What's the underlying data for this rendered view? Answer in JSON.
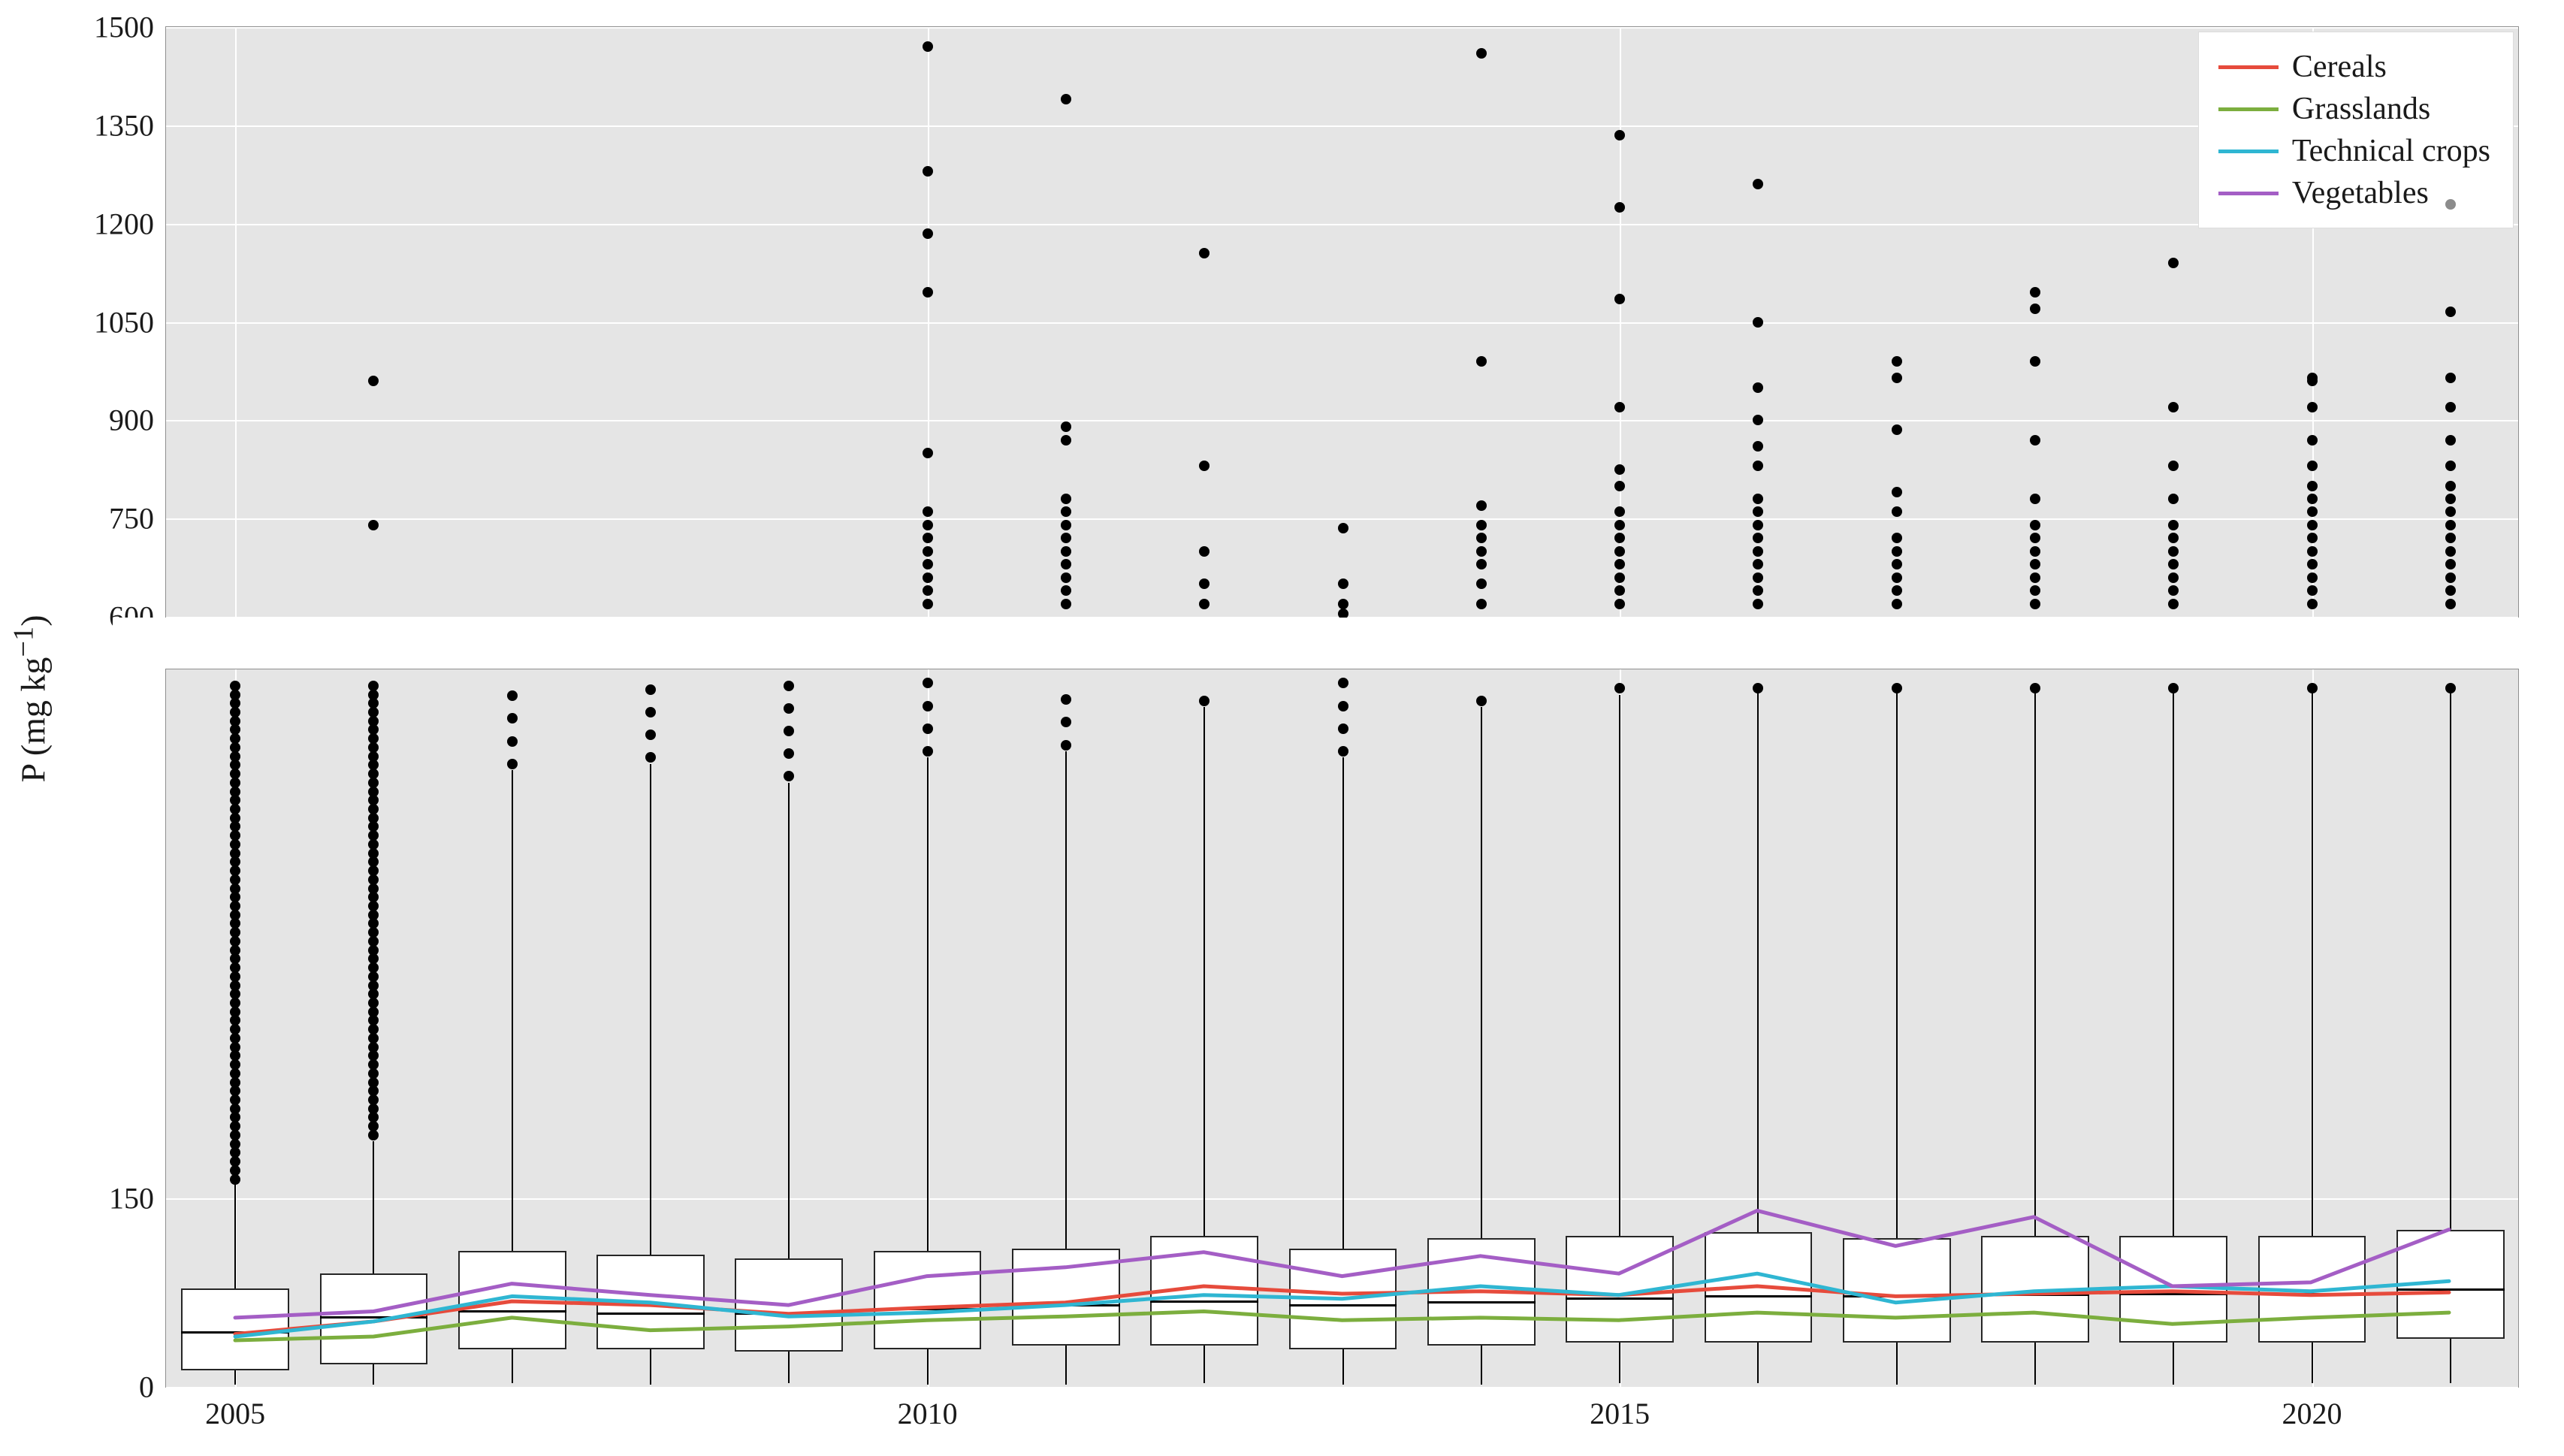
{
  "meta": {
    "x_years": [
      2005,
      2006,
      2007,
      2008,
      2009,
      2010,
      2011,
      2012,
      2013,
      2014,
      2015,
      2016,
      2017,
      2018,
      2019,
      2020,
      2021
    ]
  },
  "axes": {
    "ylabel_html": "P (mg kg<sup>−1</sup>)",
    "ylabel": "P (mg kg−1)",
    "upper": {
      "min": 600,
      "max": 1500,
      "ticks": [
        600,
        750,
        900,
        1050,
        1200,
        1350,
        1500
      ]
    },
    "lower": {
      "min": 0,
      "max": 200,
      "visible_max": 570,
      "ticks": [
        0,
        150
      ]
    },
    "xticks": [
      2005,
      2010,
      2015,
      2020
    ]
  },
  "series_colors": {
    "Cereals": "#e64b3c",
    "Grasslands": "#7cae3e",
    "Technical crops": "#2fb6d2",
    "Vegetables": "#a45ec5"
  },
  "chart_data": {
    "type": "boxplot+lines",
    "title": "",
    "xlabel": "",
    "ylabel": "P (mg kg−1)",
    "x": [
      2005,
      2006,
      2007,
      2008,
      2009,
      2010,
      2011,
      2012,
      2013,
      2014,
      2015,
      2016,
      2017,
      2018,
      2019,
      2020,
      2021
    ],
    "y_break": {
      "from": 200,
      "to": 570
    },
    "ylim_lower": [
      0,
      570
    ],
    "ylim_upper": [
      600,
      1500
    ],
    "box": {
      "q1": [
        13,
        18,
        30,
        30,
        28,
        30,
        33,
        33,
        30,
        33,
        35,
        35,
        35,
        35,
        35,
        35,
        38
      ],
      "median": [
        43,
        55,
        60,
        58,
        58,
        62,
        65,
        68,
        65,
        67,
        70,
        72,
        72,
        73,
        74,
        74,
        77
      ],
      "q3": [
        78,
        90,
        108,
        105,
        102,
        108,
        110,
        120,
        110,
        118,
        120,
        123,
        118,
        120,
        120,
        120,
        125
      ],
      "whisk_lo": [
        2,
        2,
        3,
        2,
        3,
        2,
        2,
        3,
        2,
        2,
        3,
        3,
        2,
        2,
        2,
        3,
        3
      ],
      "whisk_hi": [
        165,
        195,
        490,
        495,
        480,
        500,
        505,
        540,
        500,
        540,
        550,
        555,
        555,
        555,
        555,
        555,
        555
      ]
    },
    "outliers_upper": {
      "2005": [],
      "2006": [
        740,
        960
      ],
      "2007": [],
      "2008": [],
      "2009": [],
      "2010": [
        620,
        640,
        660,
        680,
        700,
        720,
        740,
        760,
        850,
        1095,
        1185,
        1280,
        1470
      ],
      "2011": [
        620,
        640,
        660,
        680,
        700,
        720,
        740,
        760,
        780,
        870,
        890,
        1390
      ],
      "2012": [
        620,
        650,
        700,
        830,
        1155
      ],
      "2013": [
        605,
        620,
        650,
        735
      ],
      "2014": [
        620,
        650,
        680,
        700,
        720,
        740,
        770,
        990,
        1460
      ],
      "2015": [
        620,
        640,
        660,
        680,
        700,
        720,
        740,
        760,
        800,
        825,
        920,
        1085,
        1225,
        1335
      ],
      "2016": [
        620,
        640,
        660,
        680,
        700,
        720,
        740,
        760,
        780,
        830,
        860,
        900,
        950,
        1050,
        1260
      ],
      "2017": [
        620,
        640,
        660,
        680,
        700,
        720,
        760,
        790,
        885,
        965,
        990
      ],
      "2018": [
        620,
        640,
        660,
        680,
        700,
        720,
        740,
        780,
        870,
        990,
        1070,
        1095
      ],
      "2019": [
        620,
        640,
        660,
        680,
        700,
        720,
        740,
        780,
        830,
        920,
        1140
      ],
      "2020": [
        620,
        640,
        660,
        680,
        700,
        720,
        740,
        760,
        780,
        800,
        830,
        870,
        920,
        960,
        965
      ],
      "2021": [
        620,
        640,
        660,
        680,
        700,
        720,
        740,
        760,
        780,
        800,
        830,
        870,
        920,
        965,
        1065,
        1230
      ]
    },
    "outliers_lower_clusters": {
      "2005": {
        "from": 165,
        "to": 560,
        "dense": true
      },
      "2006": {
        "from": 200,
        "to": 560,
        "dense": true
      },
      "2007": {
        "from": 495,
        "to": 560,
        "dense": false
      },
      "2008": {
        "from": 500,
        "to": 560,
        "dense": false
      },
      "2009": {
        "from": 485,
        "to": 560,
        "dense": false
      },
      "2010": {
        "from": 505,
        "to": 560,
        "dense": false
      },
      "2011": {
        "from": 510,
        "to": 560,
        "dense": false
      },
      "2012": {
        "from": 545,
        "to": 560,
        "dense": false
      },
      "2013": {
        "from": 505,
        "to": 560,
        "dense": false
      },
      "2014": {
        "from": 545,
        "to": 560,
        "dense": false
      },
      "2015": {
        "from": 555,
        "to": 560,
        "dense": false
      },
      "2016": {
        "from": 555,
        "to": 560,
        "dense": false
      },
      "2017": {
        "from": 555,
        "to": 560,
        "dense": false
      },
      "2018": {
        "from": 555,
        "to": 560,
        "dense": false
      },
      "2019": {
        "from": 555,
        "to": 560,
        "dense": false
      },
      "2020": {
        "from": 555,
        "to": 560,
        "dense": false
      },
      "2021": {
        "from": 555,
        "to": 560,
        "dense": false
      }
    },
    "series": [
      {
        "name": "Cereals",
        "values": [
          42,
          52,
          68,
          65,
          58,
          63,
          67,
          80,
          74,
          76,
          73,
          80,
          72,
          74,
          76,
          73,
          75
        ]
      },
      {
        "name": "Grasslands",
        "values": [
          37,
          40,
          55,
          45,
          48,
          53,
          56,
          60,
          53,
          55,
          53,
          59,
          55,
          59,
          50,
          55,
          59
        ]
      },
      {
        "name": "Technical crops",
        "values": [
          40,
          52,
          72,
          67,
          56,
          59,
          65,
          73,
          70,
          80,
          73,
          90,
          67,
          76,
          80,
          76,
          84
        ]
      },
      {
        "name": "Vegetables",
        "values": [
          55,
          60,
          82,
          73,
          65,
          88,
          95,
          107,
          88,
          104,
          90,
          140,
          112,
          135,
          80,
          83,
          125
        ]
      }
    ],
    "legend": [
      "Cereals",
      "Grasslands",
      "Technical crops",
      "Vegetables"
    ],
    "legend_pos": "top-right"
  }
}
